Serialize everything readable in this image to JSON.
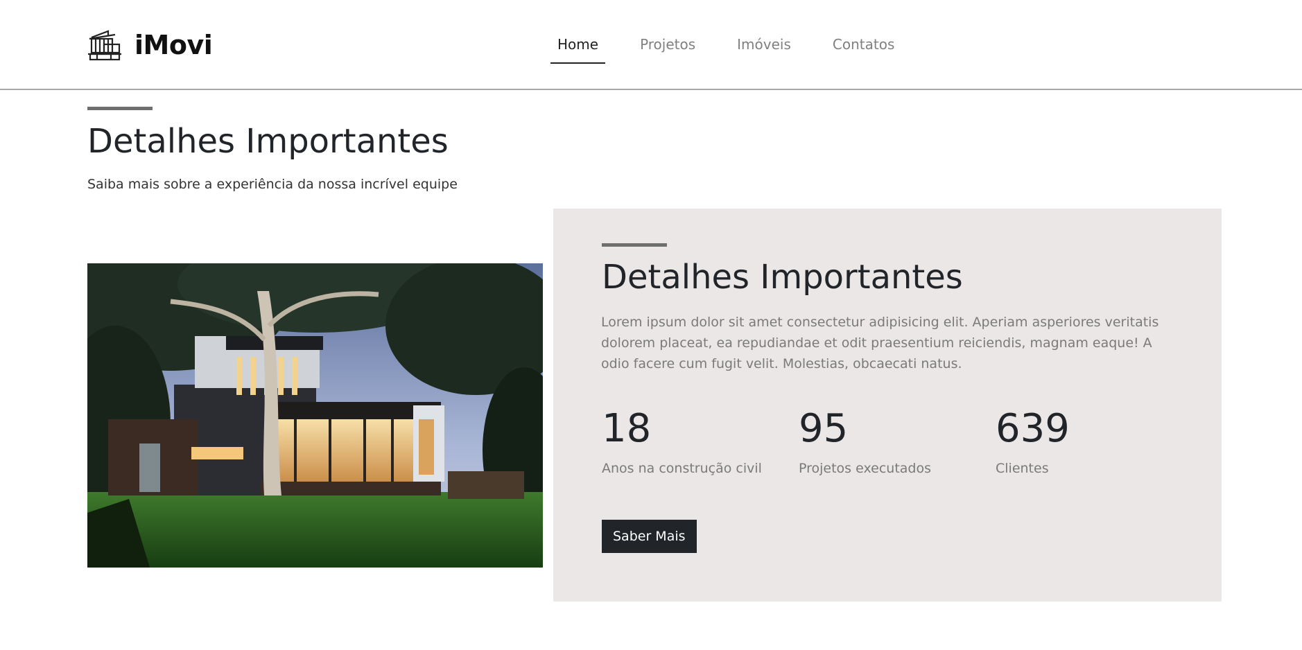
{
  "header": {
    "brand_name": "iMovi",
    "brand_icon": "building-icon",
    "nav": [
      {
        "label": "Home",
        "active": true
      },
      {
        "label": "Projetos",
        "active": false
      },
      {
        "label": "Imóveis",
        "active": false
      },
      {
        "label": "Contatos",
        "active": false
      }
    ]
  },
  "intro": {
    "title": "Detalhes Importantes",
    "subtitle": "Saiba mais sobre a experiência da nossa incrível equipe"
  },
  "details": {
    "title": "Detalhes Importantes",
    "text": "Lorem ipsum dolor sit amet consectetur adipisicing elit. Aperiam asperiores veritatis dolorem placeat, ea repudiandae et odit praesentium reiciendis, magnam eaque! A odio facere cum fugit velit. Molestias, obcaecati natus.",
    "stats": [
      {
        "number": "18",
        "label": "Anos na construção civil"
      },
      {
        "number": "95",
        "label": "Projetos executados"
      },
      {
        "number": "639",
        "label": "Clientes"
      }
    ],
    "button_label": "Saber Mais"
  },
  "colors": {
    "panel_background": "#ebe7e7",
    "button_background": "#212529",
    "accent_line": "#6f6f6f"
  }
}
